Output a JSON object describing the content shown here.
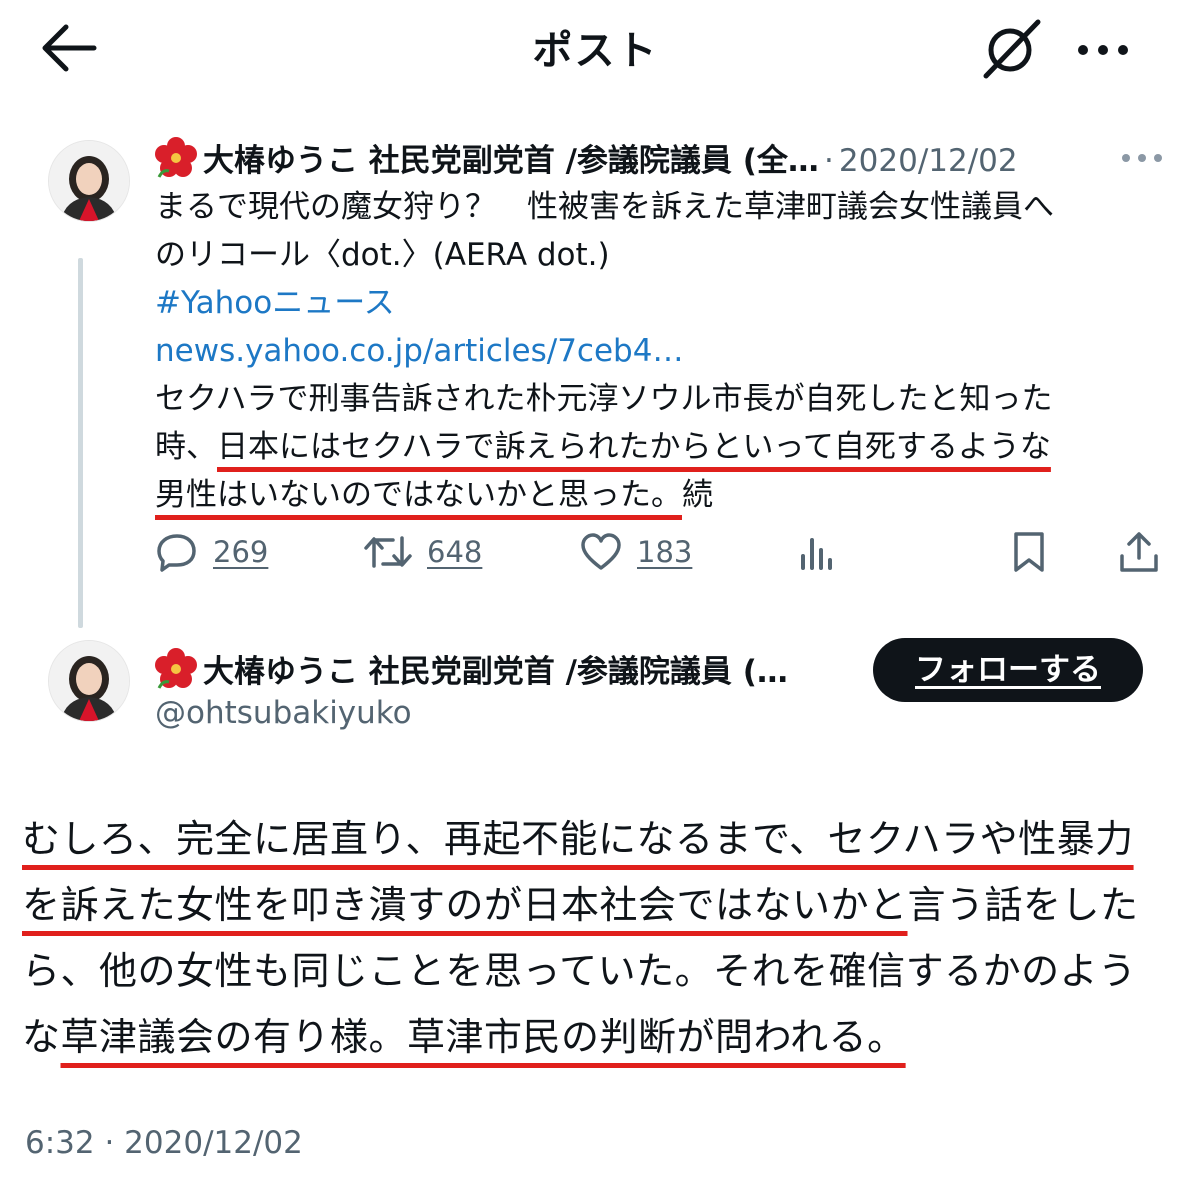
{
  "header": {
    "title": "ポスト"
  },
  "tweet1": {
    "author_name": "大椿ゆうこ 社民党副党首 /参議院議員 (全…",
    "separator": "·",
    "date": "2020/12/02",
    "text": {
      "line1": "まるで現代の魔女狩り？　性被害を訴えた草津町議会女性議員へ",
      "line2": "のリコール〈dot.〉(AERA dot.)",
      "hashtag": "#Yahooニュース",
      "url": "news.yahoo.co.jp/articles/7ceb4…",
      "line5": "セクハラで刑事告訴された朴元淳ソウル市長が自死したと知った",
      "line6_pre": "時、",
      "line6_ul": "日本にはセクハラで訴えられたからといって自死するような",
      "line7_ul": "男性はいないのではないかと思った。",
      "line7_post": "続"
    },
    "stats": {
      "replies": "269",
      "reposts": "648",
      "likes": "183"
    }
  },
  "tweet2": {
    "author_name": "大椿ゆうこ 社民党副党首 /参議院議員 (…",
    "handle": "@ohtsubakiyuko",
    "follow_label": "フォローする",
    "text": {
      "l1_ul": "むしろ、完全に居直り、再起不能になるまで、セクハラや性暴力",
      "l2_ul": "を訴えた女性を叩き潰すのが日本社会ではないかと",
      "l2_post": "言う話をした",
      "l3": "ら、他の女性も同じことを思っていた。それを確信するかのよう",
      "l4_pre": "な",
      "l4_ul": "草津議会の有り様。草津市民の判断が問われる。"
    },
    "timestamp": "6:32 · 2020/12/02"
  },
  "colors": {
    "link": "#1d78c5",
    "annotation": "#e0201c",
    "text": "#0f1419",
    "muted": "#536471"
  },
  "icons": [
    "back-arrow-icon",
    "grok-icon",
    "more-icon",
    "hibiscus-icon",
    "reply-icon",
    "repost-icon",
    "like-icon",
    "views-icon",
    "bookmark-icon",
    "share-icon"
  ]
}
